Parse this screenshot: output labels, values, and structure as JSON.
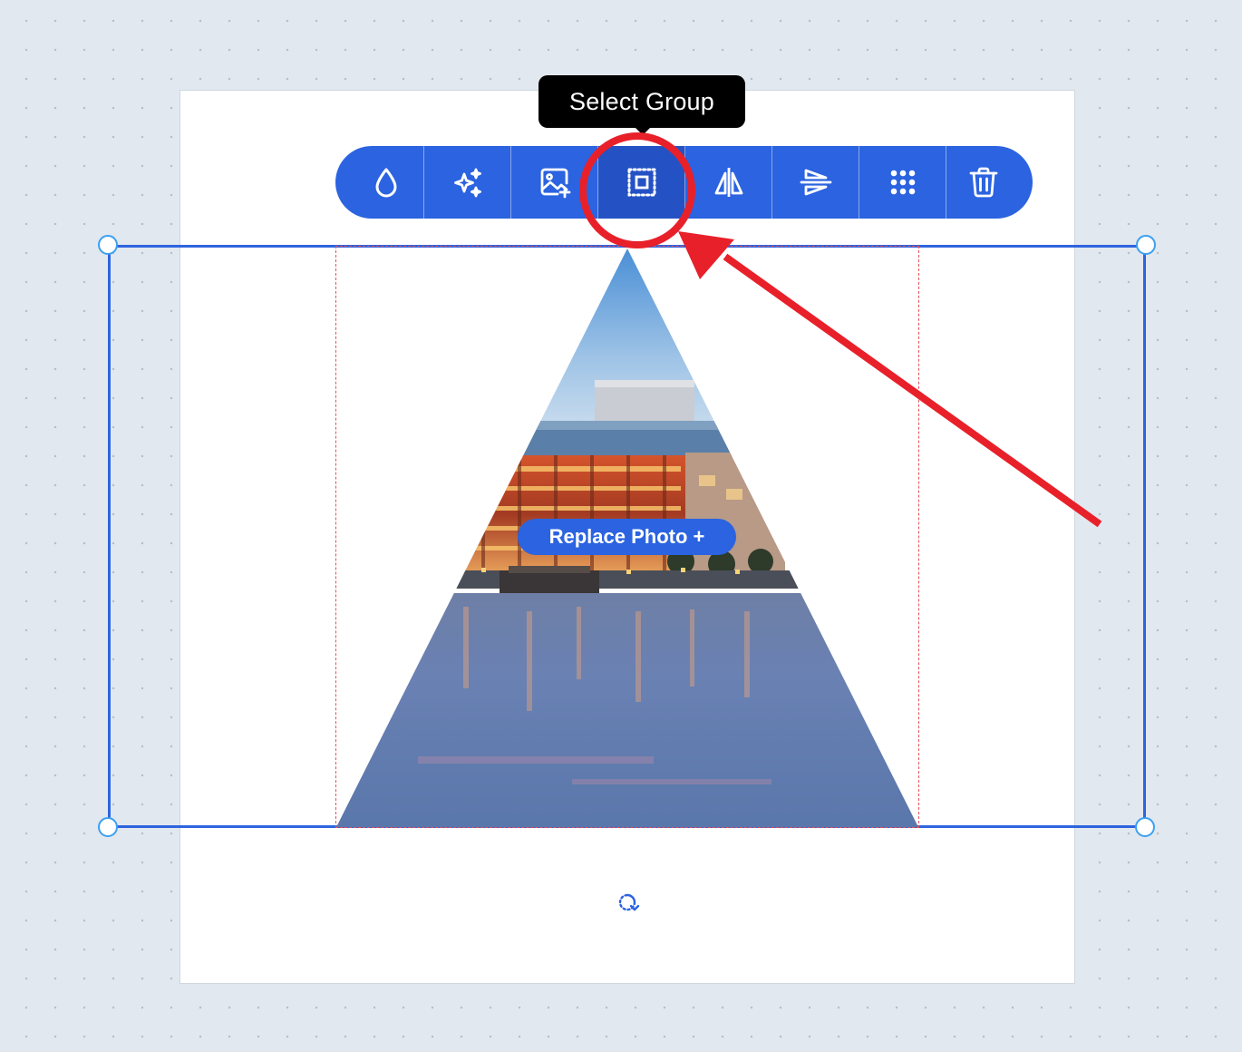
{
  "tooltip": {
    "text": "Select Group"
  },
  "toolbar": {
    "buttons": [
      {
        "name": "transparency",
        "icon": "droplet-icon"
      },
      {
        "name": "magic",
        "icon": "sparkles-icon"
      },
      {
        "name": "replace-image",
        "icon": "image-plus-icon"
      },
      {
        "name": "select-group",
        "icon": "select-group-icon",
        "active": true
      },
      {
        "name": "flip-horizontal",
        "icon": "flip-horizontal-icon"
      },
      {
        "name": "flip-vertical",
        "icon": "flip-vertical-icon"
      },
      {
        "name": "more",
        "icon": "dots-grid-icon"
      },
      {
        "name": "delete",
        "icon": "trash-icon"
      }
    ]
  },
  "canvas": {
    "replace_photo_label": "Replace Photo +",
    "rotate_icon": "rotate-icon"
  },
  "colors": {
    "accent": "#2b63e0",
    "annotation": "#e8202a",
    "background": "#e2e8f0"
  }
}
